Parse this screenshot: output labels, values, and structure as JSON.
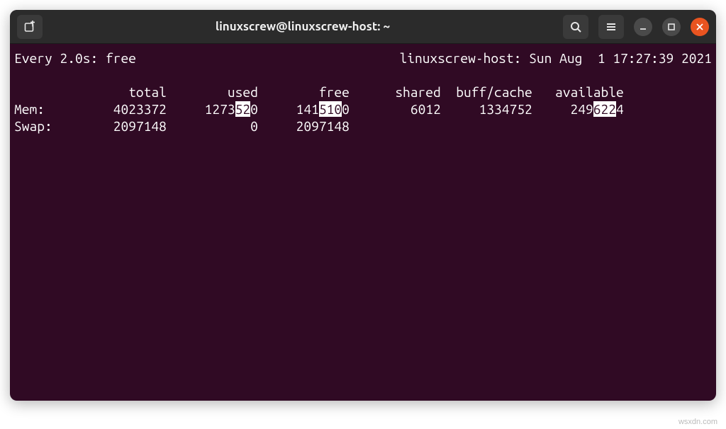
{
  "window": {
    "title": "linuxscrew@linuxscrew-host: ~"
  },
  "watch": {
    "interval_label": "Every 2.0s:",
    "command": "free",
    "hoststamp": "linuxscrew-host: Sun Aug  1 17:27:39 2021"
  },
  "table": {
    "headers": {
      "total": "total",
      "used": "used",
      "free": "free",
      "shared": "shared",
      "buffcache": "buff/cache",
      "available": "available"
    },
    "rows": {
      "mem": {
        "label": "Mem:",
        "total": "4023372",
        "used_a": "1273",
        "used_b": "52",
        "used_c": "0",
        "free_a": "141",
        "free_b": "510",
        "free_c": "0",
        "shared": "6012",
        "buffcache": "1334752",
        "avail_a": "249",
        "avail_b": "622",
        "avail_c": "4"
      },
      "swap": {
        "label": "Swap:",
        "total": "2097148",
        "used": "0",
        "free": "2097148"
      }
    }
  },
  "watermark": "wsxdn.com"
}
